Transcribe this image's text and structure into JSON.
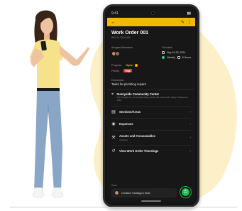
{
  "status_bar": {
    "time": "9:41"
  },
  "work_order": {
    "title": "Work Order 001",
    "subtitle": "WO-11-2024-001",
    "assigned_label": "Assigned Members",
    "schedule_label": "Schedule",
    "date": "Sep 19-20, 2024",
    "repeat": "Weekly",
    "hours": "8 Hours",
    "progress_label": "Progress",
    "status": "Open",
    "priority_label": "Priority",
    "priority": "High",
    "description_label": "Description",
    "description": "Tasks for plumbing repairs",
    "location_name": "Sunnyside Community Center",
    "location_addr": "123 Sunlight St., Sunnyside Valley, Suite 100, Sunnyside Valley, Philippines, 1234"
  },
  "menu": [
    {
      "label": "Sections/Areas",
      "sub": "",
      "icon": "sections-icon"
    },
    {
      "label": "Expenses",
      "sub": "",
      "icon": "expenses-icon"
    },
    {
      "label": "Assets and Consumables",
      "sub": "4 item(s)",
      "icon": "assets-icon"
    },
    {
      "label": "View Work Order Timeslogs",
      "sub": "",
      "icon": "history-icon"
    }
  ],
  "team_label": "Team",
  "assignee_name": "Christine Santiago's Note",
  "colors": {
    "accent": "#f5b800",
    "screen_bg": "#171717",
    "priority": "#e53935",
    "fab": "#1db954",
    "blob": "#fdf0c8"
  }
}
